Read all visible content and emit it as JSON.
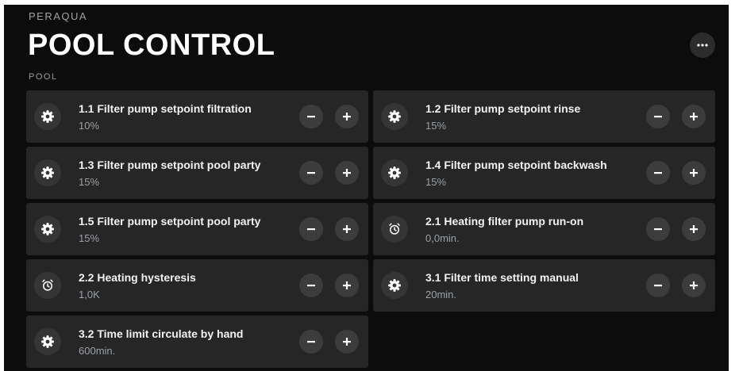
{
  "header": {
    "brand": "PERAQUA",
    "title": "POOL CONTROL",
    "section": "POOL",
    "more_icon": "more-horizontal-icon"
  },
  "settings": [
    {
      "label": "1.1  Filter pump setpoint filtration",
      "value": "10%",
      "icon": "gear-icon"
    },
    {
      "label": "1.2  Filter pump setpoint rinse",
      "value": "15%",
      "icon": "gear-icon"
    },
    {
      "label": "1.3  Filter pump setpoint pool party",
      "value": "15%",
      "icon": "gear-icon"
    },
    {
      "label": "1.4  Filter pump setpoint backwash",
      "value": "15%",
      "icon": "gear-icon"
    },
    {
      "label": "1.5  Filter pump setpoint pool party",
      "value": "15%",
      "icon": "gear-icon"
    },
    {
      "label": "2.1  Heating filter pump run-on",
      "value": "0,0min.",
      "icon": "alarm-clock-icon"
    },
    {
      "label": "2.2  Heating hysteresis",
      "value": "1,0K",
      "icon": "alarm-clock-icon"
    },
    {
      "label": "3.1  Filter time setting manual",
      "value": "20min.",
      "icon": "gear-icon"
    },
    {
      "label": "3.2  Time limit circulate by hand",
      "value": "600min.",
      "icon": "gear-icon"
    }
  ],
  "controls": {
    "decrement_icon": "minus-icon",
    "increment_icon": "plus-icon"
  },
  "colors": {
    "background": "#0c0c0c",
    "card": "#262626",
    "button": "#3c3c3c",
    "text": "#f2f2f2",
    "value": "#9aa0a6"
  }
}
